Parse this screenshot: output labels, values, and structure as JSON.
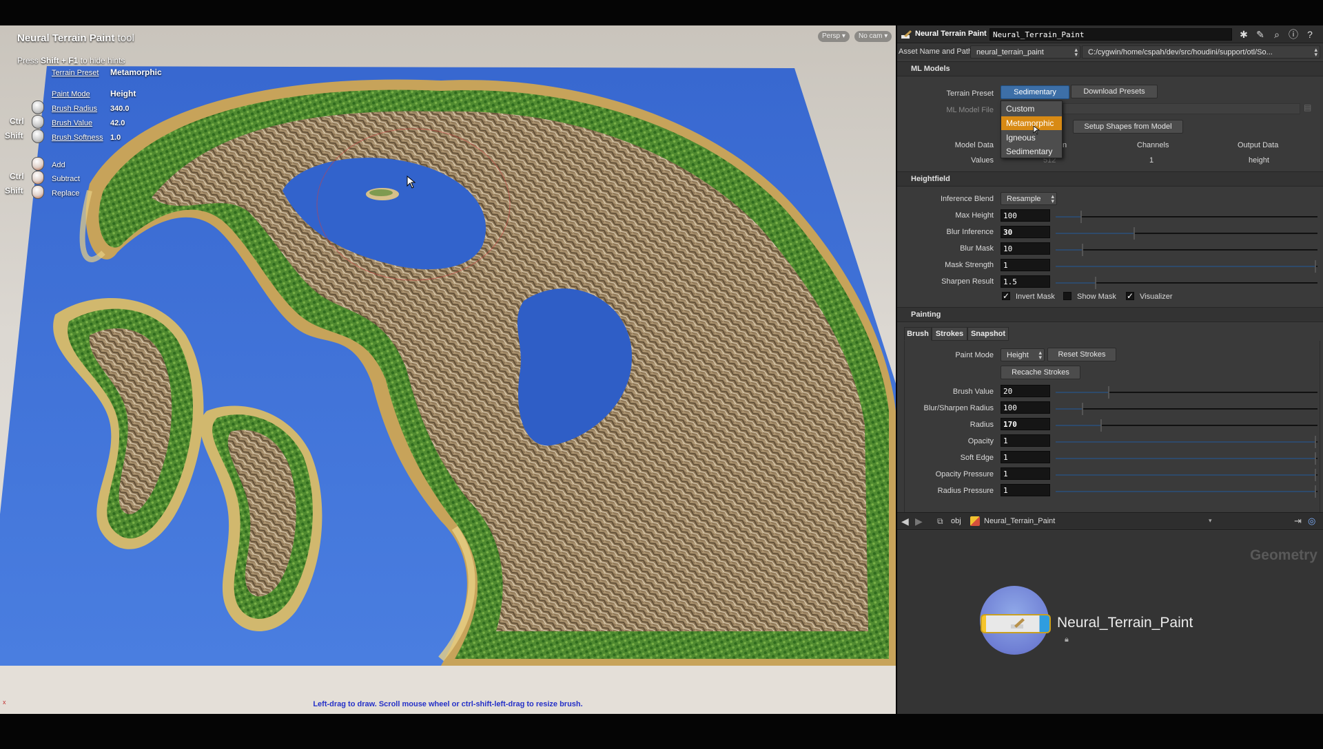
{
  "viewport": {
    "tool_title_bold": "Neural Terrain Paint",
    "tool_title_suffix": "tool",
    "hint_prefix": "Press ",
    "hint_keys": "Shift + F1",
    "hint_suffix": " to hide hints",
    "persp_button": "Persp",
    "cam_button": "No cam",
    "status_text": "Left-drag to draw. Scroll mouse wheel or ctrl-shift-left-drag to resize brush.",
    "axis_label": "x",
    "hud": {
      "terrain_preset_label": "Terrain Preset",
      "terrain_preset_value": "Metamorphic",
      "paint_mode_label": "Paint Mode",
      "paint_mode_value": "Height",
      "brush_radius_label": "Brush Radius",
      "brush_radius_value": "340.0",
      "brush_value_label": "Brush Value",
      "brush_value_value": "42.0",
      "brush_softness_label": "Brush Softness",
      "brush_softness_value": "1.0",
      "mod_ctrl": "Ctrl",
      "mod_shift": "Shift",
      "add_label": "Add",
      "subtract_label": "Subtract",
      "replace_label": "Replace"
    }
  },
  "panel": {
    "node_type": "Neural Terrain Paint",
    "node_name": "Neural_Terrain_Paint",
    "asset_label": "Asset Name and Path",
    "asset_name": "neural_terrain_paint",
    "asset_path": "C:/cygwin/home/cspah/dev/src/houdini/support/otl/So...",
    "ml_models": {
      "section": "ML Models",
      "terrain_preset_label": "Terrain Preset",
      "terrain_preset_value": "Sedimentary",
      "download_presets": "Download Presets",
      "ml_model_file_label": "ML Model File",
      "setup_shapes": "Setup Shapes from Model",
      "model_data_label": "Model Data",
      "values_label": "Values",
      "col_input_partial": "n",
      "col_channels": "Channels",
      "col_output": "Output Data",
      "val_input_partial": "512",
      "val_channels": "1",
      "val_output": "height",
      "preset_menu": [
        "Custom",
        "Metamorphic",
        "Igneous",
        "Sedimentary"
      ],
      "preset_menu_highlight": "Metamorphic"
    },
    "heightfield": {
      "section": "Heightfield",
      "inference_blend_label": "Inference Blend",
      "inference_blend_value": "Resample",
      "max_height_label": "Max Height",
      "max_height": "100",
      "blur_inference_label": "Blur Inference",
      "blur_inference": "30",
      "blur_mask_label": "Blur Mask",
      "blur_mask": "10",
      "mask_strength_label": "Mask Strength",
      "mask_strength": "1",
      "sharpen_result_label": "Sharpen Result",
      "sharpen_result": "1.5",
      "invert_mask_label": "Invert Mask",
      "invert_mask": true,
      "show_mask_label": "Show Mask",
      "show_mask": false,
      "visualizer_label": "Visualizer",
      "visualizer": true
    },
    "painting": {
      "section": "Painting",
      "tabs": [
        "Brush",
        "Strokes",
        "Snapshot"
      ],
      "paint_mode_label": "Paint Mode",
      "paint_mode_value": "Height",
      "reset_strokes": "Reset Strokes",
      "recache_strokes": "Recache Strokes",
      "brush_value_label": "Brush Value",
      "brush_value": "20",
      "blur_sharpen_label": "Blur/Sharpen Radius",
      "blur_sharpen": "100",
      "radius_label": "Radius",
      "radius": "170",
      "opacity_label": "Opacity",
      "opacity": "1",
      "soft_edge_label": "Soft Edge",
      "soft_edge": "1",
      "opacity_pressure_label": "Opacity Pressure",
      "opacity_pressure": "1",
      "radius_pressure_label": "Radius Pressure",
      "radius_pressure": "1"
    },
    "network": {
      "path_obj": "obj",
      "path_node": "Neural_Terrain_Paint",
      "context_label": "Geometry",
      "node_label": "Neural_Terrain_Paint"
    }
  },
  "colors": {
    "accent_menu_highlight": "#d88a14",
    "selected_button": "#3d6fa7",
    "water": "#3f70d8",
    "status_text": "#2430c8"
  }
}
